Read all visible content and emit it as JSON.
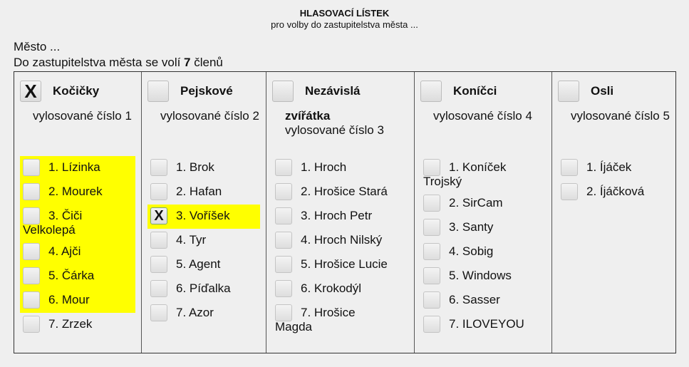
{
  "header": {
    "title": "HLASOVACÍ LÍSTEK",
    "subtitle": "pro volby do zastupitelstva města ...",
    "city": "Město ...",
    "members_prefix": "Do zastupitelstva města se volí ",
    "members_count": "7",
    "members_suffix": " členů"
  },
  "colors": {
    "highlight": "#ffff00",
    "border": "#333333",
    "background": "#efefef"
  },
  "check_mark": "X",
  "parties": [
    {
      "name": "Kočičky",
      "name_cont": "",
      "checked": true,
      "number_label": "vylosované číslo 1",
      "candidates": [
        {
          "label": "1. Lízinka",
          "cont": "",
          "highlighted": true,
          "checked": false
        },
        {
          "label": "2. Mourek",
          "cont": "",
          "highlighted": true,
          "checked": false
        },
        {
          "label": "3. Čiči",
          "cont": "Velkolepá",
          "highlighted": true,
          "checked": false
        },
        {
          "label": "4. Ajči",
          "cont": "",
          "highlighted": true,
          "checked": false
        },
        {
          "label": "5. Čárka",
          "cont": "",
          "highlighted": true,
          "checked": false
        },
        {
          "label": "6. Mour",
          "cont": "",
          "highlighted": true,
          "checked": false
        },
        {
          "label": "7. Zrzek",
          "cont": "",
          "highlighted": false,
          "checked": false
        }
      ]
    },
    {
      "name": "Pejskové",
      "name_cont": "",
      "checked": false,
      "number_label": "vylosované číslo 2",
      "candidates": [
        {
          "label": "1. Brok",
          "cont": "",
          "highlighted": false,
          "checked": false
        },
        {
          "label": "2. Hafan",
          "cont": "",
          "highlighted": false,
          "checked": false
        },
        {
          "label": "3. Voříšek",
          "cont": "",
          "highlighted": true,
          "checked": true
        },
        {
          "label": "4. Tyr",
          "cont": "",
          "highlighted": false,
          "checked": false
        },
        {
          "label": "5. Agent",
          "cont": "",
          "highlighted": false,
          "checked": false
        },
        {
          "label": "6. Píďalka",
          "cont": "",
          "highlighted": false,
          "checked": false
        },
        {
          "label": "7. Azor",
          "cont": "",
          "highlighted": false,
          "checked": false
        }
      ]
    },
    {
      "name": "Nezávislá",
      "name_cont": "zvířátka",
      "checked": false,
      "number_label": "vylosované číslo 3",
      "candidates": [
        {
          "label": "1. Hroch",
          "cont": "",
          "highlighted": false,
          "checked": false
        },
        {
          "label": "2. Hrošice Stará",
          "cont": "",
          "highlighted": false,
          "checked": false
        },
        {
          "label": "3. Hroch Petr",
          "cont": "",
          "highlighted": false,
          "checked": false
        },
        {
          "label": "4. Hroch Nilský",
          "cont": "",
          "highlighted": false,
          "checked": false
        },
        {
          "label": "5. Hrošice Lucie",
          "cont": "",
          "highlighted": false,
          "checked": false
        },
        {
          "label": "6. Krokodýl",
          "cont": "",
          "highlighted": false,
          "checked": false
        },
        {
          "label": "7. Hrošice",
          "cont": "Magda",
          "highlighted": false,
          "checked": false
        }
      ]
    },
    {
      "name": "Koníčci",
      "name_cont": "",
      "checked": false,
      "number_label": "vylosované číslo 4",
      "candidates": [
        {
          "label": "1. Koníček",
          "cont": "Trojský",
          "highlighted": false,
          "checked": false
        },
        {
          "label": "2. SirCam",
          "cont": "",
          "highlighted": false,
          "checked": false
        },
        {
          "label": "3. Santy",
          "cont": "",
          "highlighted": false,
          "checked": false
        },
        {
          "label": "4. Sobig",
          "cont": "",
          "highlighted": false,
          "checked": false
        },
        {
          "label": "5. Windows",
          "cont": "",
          "highlighted": false,
          "checked": false
        },
        {
          "label": "6. Sasser",
          "cont": "",
          "highlighted": false,
          "checked": false
        },
        {
          "label": "7. ILOVEYOU",
          "cont": "",
          "highlighted": false,
          "checked": false
        }
      ]
    },
    {
      "name": "Osli",
      "name_cont": "",
      "checked": false,
      "number_label": "vylosované číslo 5",
      "candidates": [
        {
          "label": "1. Íjáček",
          "cont": "",
          "highlighted": false,
          "checked": false
        },
        {
          "label": "2. Íjáčková",
          "cont": "",
          "highlighted": false,
          "checked": false
        }
      ]
    }
  ]
}
